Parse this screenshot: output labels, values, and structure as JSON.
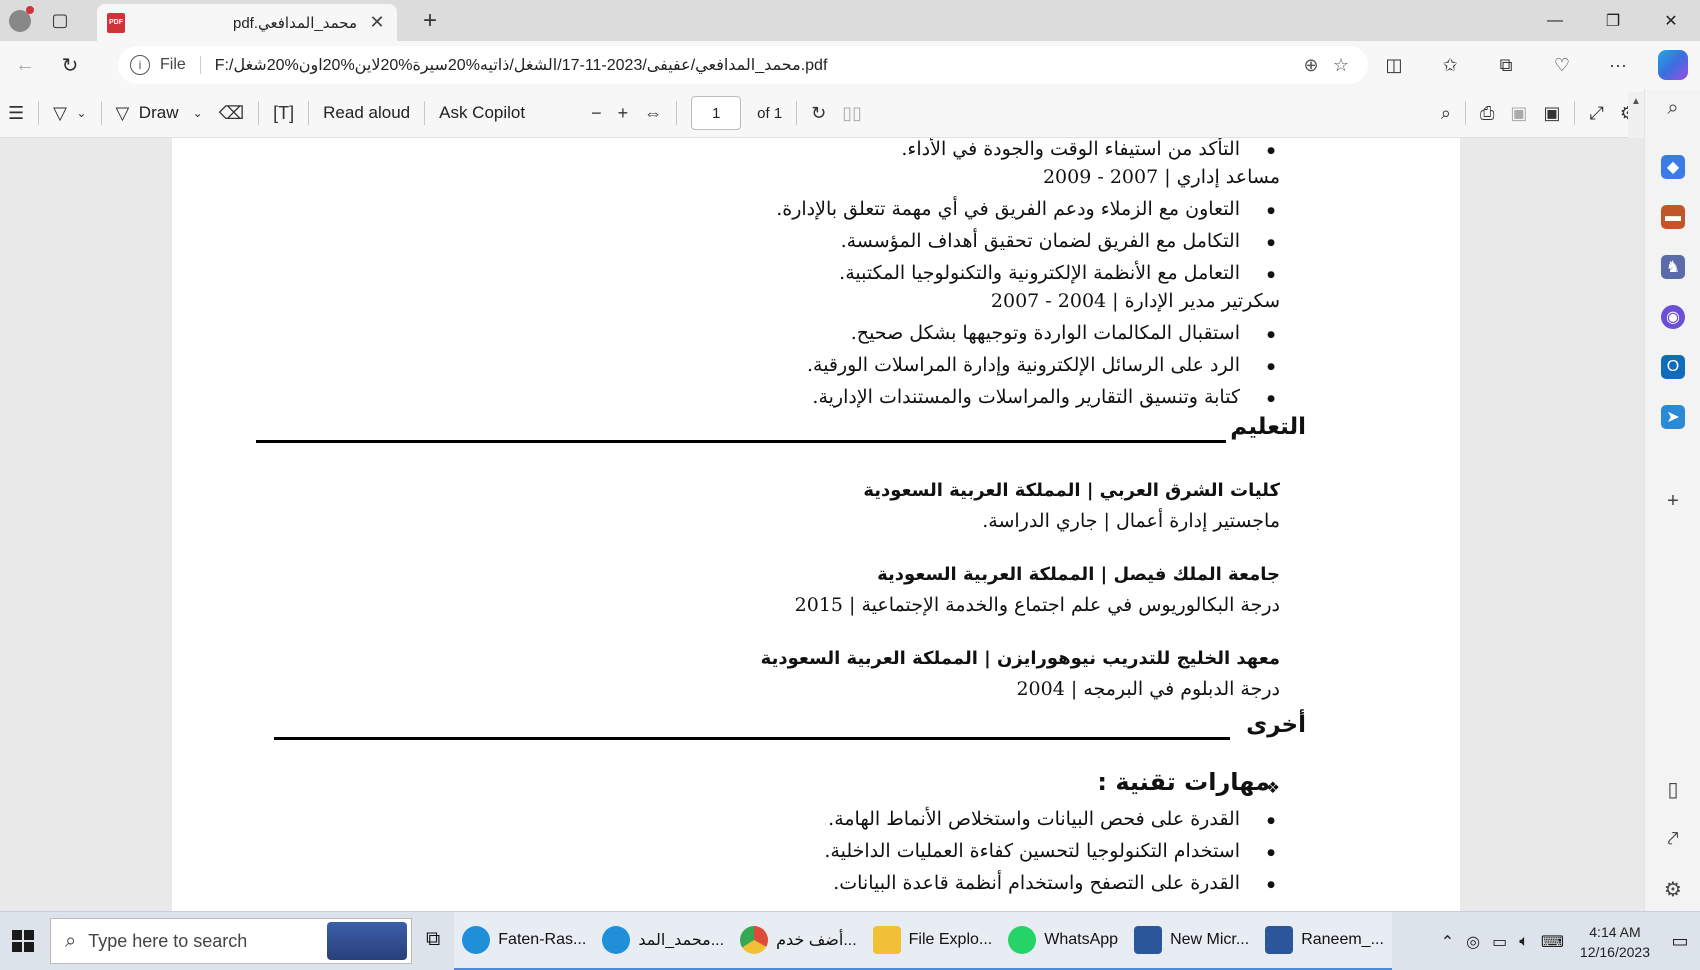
{
  "browser": {
    "tab_title": "محمد_المدافعي.pdf",
    "tab_icon": "pdf-icon",
    "file_label": "File",
    "url": "F:/محمد_المدافعي/عفيفى/2023-11-17/الشغل/ذاتيه%20سيرة%20لاين%20اون%20شغل.pdf"
  },
  "pdf_toolbar": {
    "draw_label": "Draw",
    "read_aloud_label": "Read aloud",
    "ask_copilot_label": "Ask Copilot",
    "page_number": "1",
    "page_count": "of 1"
  },
  "document": {
    "lines": {
      "l0": "التأكد من استيفاء الوقت والجودة في الأداء.",
      "l1": "مساعد إداري | 2007 - 2009",
      "l2": "التعاون مع الزملاء ودعم الفريق في أي مهمة تتعلق بالإدارة.",
      "l3": "التكامل مع الفريق لضمان تحقيق أهداف المؤسسة.",
      "l4": "التعامل مع الأنظمة الإلكترونية والتكنولوجيا المكتبية.",
      "l5": "سكرتير مدير الإدارة | 2004 - 2007",
      "l6": "استقبال المكالمات الواردة وتوجيهها بشكل صحيح.",
      "l7": "الرد على الرسائل الإلكترونية وإدارة المراسلات الورقية.",
      "l8": "كتابة وتنسيق التقارير والمراسلات والمستندات الإدارية."
    },
    "education_heading": "التعليم",
    "education": [
      {
        "institution": "كليات الشرق العربي | المملكة العربية السعودية",
        "detail": "ماجستير إدارة أعمال | جاري الدراسة."
      },
      {
        "institution": "جامعة الملك فيصل | المملكة العربية السعودية",
        "detail": "درجة البكالوريوس في علم اجتماع والخدمة الإجتماعية | 2015"
      },
      {
        "institution": "معهد الخليج للتدريب نيوهورايزن | المملكة العربية السعودية",
        "detail": "درجة الدبلوم في البرمجه | 2004"
      }
    ],
    "other_heading": "أخرى",
    "tech_skills_heading": "مهارات تقنية :",
    "tech_skills": [
      "القدرة على فحص البيانات واستخلاص الأنماط الهامة.",
      "استخدام التكنولوجيا لتحسين كفاءة العمليات الداخلية.",
      "القدرة على التصفح واستخدام أنظمة قاعدة البيانات."
    ]
  },
  "taskbar": {
    "search_placeholder": "Type here to search",
    "items": [
      {
        "label": "Faten-Ras...",
        "icon": "edge-icon",
        "color": "#1f8fd8"
      },
      {
        "label": "محمد_المد...",
        "icon": "edge-icon",
        "color": "#1f8fd8"
      },
      {
        "label": "أضف خدم...",
        "icon": "chrome-icon",
        "color": "#e04a3a"
      },
      {
        "label": "File Explo...",
        "icon": "folder-icon",
        "color": "#f2c037"
      },
      {
        "label": "WhatsApp",
        "icon": "whatsapp-icon",
        "color": "#25d366"
      },
      {
        "label": "New Micr...",
        "icon": "word-icon",
        "color": "#2b579a"
      },
      {
        "label": "Raneem_...",
        "icon": "word-icon",
        "color": "#2b579a"
      }
    ],
    "time": "4:14 AM",
    "date": "12/16/2023"
  },
  "colors": {
    "pdf_red": "#d13438",
    "accent_blue": "#4f8ad9"
  }
}
